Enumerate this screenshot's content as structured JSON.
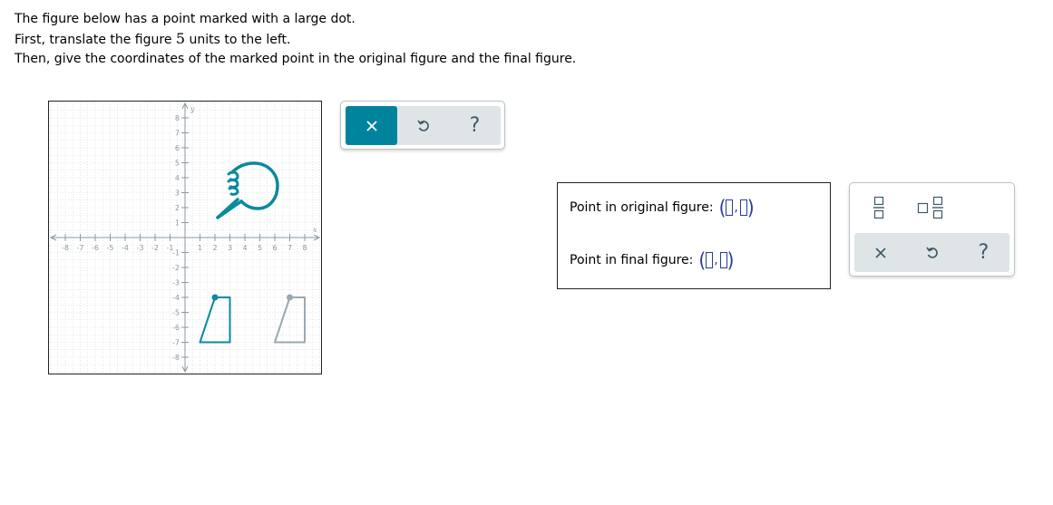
{
  "instructions": {
    "line1": "The figure below has a point marked with a large dot.",
    "line2_before": "First, translate the figure ",
    "line2_number": "5",
    "line2_after": " units to the left.",
    "line3": "Then, give the coordinates of the marked point in the original figure and the final figure."
  },
  "graph": {
    "x_axis_label": "x",
    "y_axis_label": "y",
    "x_range": [
      -8,
      8
    ],
    "y_range": [
      -8,
      8
    ],
    "x_ticks": [
      "-8",
      "-7",
      "-6",
      "-5",
      "-4",
      "-3",
      "-2",
      "-1",
      "1",
      "2",
      "3",
      "4",
      "5",
      "6",
      "7",
      "8"
    ],
    "y_ticks": [
      "8",
      "7",
      "6",
      "5",
      "4",
      "3",
      "2",
      "1",
      "-1",
      "-2",
      "-3",
      "-4",
      "-5",
      "-6",
      "-7",
      "-8"
    ],
    "figures": {
      "translated_figure": {
        "points": [
          [
            2,
            -4
          ],
          [
            3,
            -4
          ],
          [
            3,
            -7
          ],
          [
            1,
            -7
          ]
        ],
        "marked_point": [
          2,
          -4
        ],
        "color": "#0a8a9c"
      },
      "original_figure": {
        "points": [
          [
            7,
            -4
          ],
          [
            8,
            -4
          ],
          [
            8,
            -7
          ],
          [
            6,
            -7
          ]
        ],
        "marked_point": [
          7,
          -4
        ],
        "color": "#9aa9b0"
      }
    },
    "pointer_icon": "pointing-hand-icon"
  },
  "graph_toolbar": {
    "clear_icon": "close-icon",
    "undo_icon": "undo-icon",
    "help_label": "?",
    "accent": "#00849e"
  },
  "answers": {
    "original_label": "Point in original figure:",
    "final_label": "Point in final figure:"
  },
  "keypad": {
    "fraction_icon": "fraction-icon",
    "mixed_number_icon": "mixed-number-icon",
    "clear_icon": "close-icon",
    "undo_icon": "undo-icon",
    "help_label": "?"
  }
}
